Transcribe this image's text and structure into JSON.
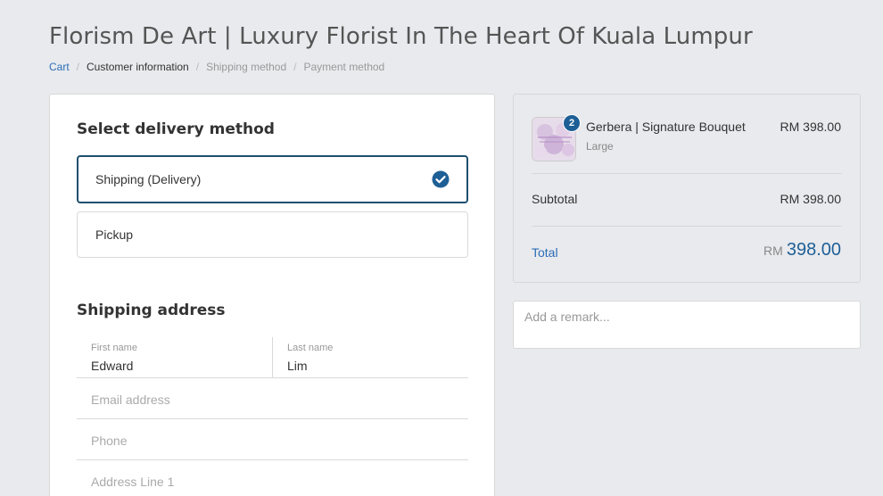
{
  "header": {
    "store_title": "Florism De Art | Luxury Florist In The Heart Of Kuala Lumpur"
  },
  "breadcrumb": {
    "items": [
      {
        "label": "Cart"
      },
      {
        "label": "Customer information"
      },
      {
        "label": "Shipping method"
      },
      {
        "label": "Payment method"
      }
    ],
    "separator": "/"
  },
  "delivery": {
    "heading": "Select delivery method",
    "options": [
      {
        "label": "Shipping (Delivery)",
        "selected": true
      },
      {
        "label": "Pickup",
        "selected": false
      }
    ]
  },
  "shipping_address": {
    "heading": "Shipping address",
    "first_name": {
      "label": "First name",
      "value": "Edward"
    },
    "last_name": {
      "label": "Last name",
      "value": "Lim"
    },
    "email": {
      "placeholder": "Email address"
    },
    "phone": {
      "placeholder": "Phone"
    },
    "address_line_1": {
      "placeholder": "Address Line 1"
    }
  },
  "order_summary": {
    "item": {
      "quantity": "2",
      "name": "Gerbera | Signature Bouquet",
      "variant": "Large",
      "price": "RM 398.00"
    },
    "subtotal_label": "Subtotal",
    "subtotal_value": "RM 398.00",
    "total_label": "Total",
    "total_currency": "RM",
    "total_amount": "398.00"
  },
  "remark": {
    "placeholder": "Add a remark..."
  },
  "colors": {
    "accent": "#1e5f96",
    "link": "#2a6db5",
    "selected_border": "#1e4f6e",
    "background": "#e9eaee"
  }
}
